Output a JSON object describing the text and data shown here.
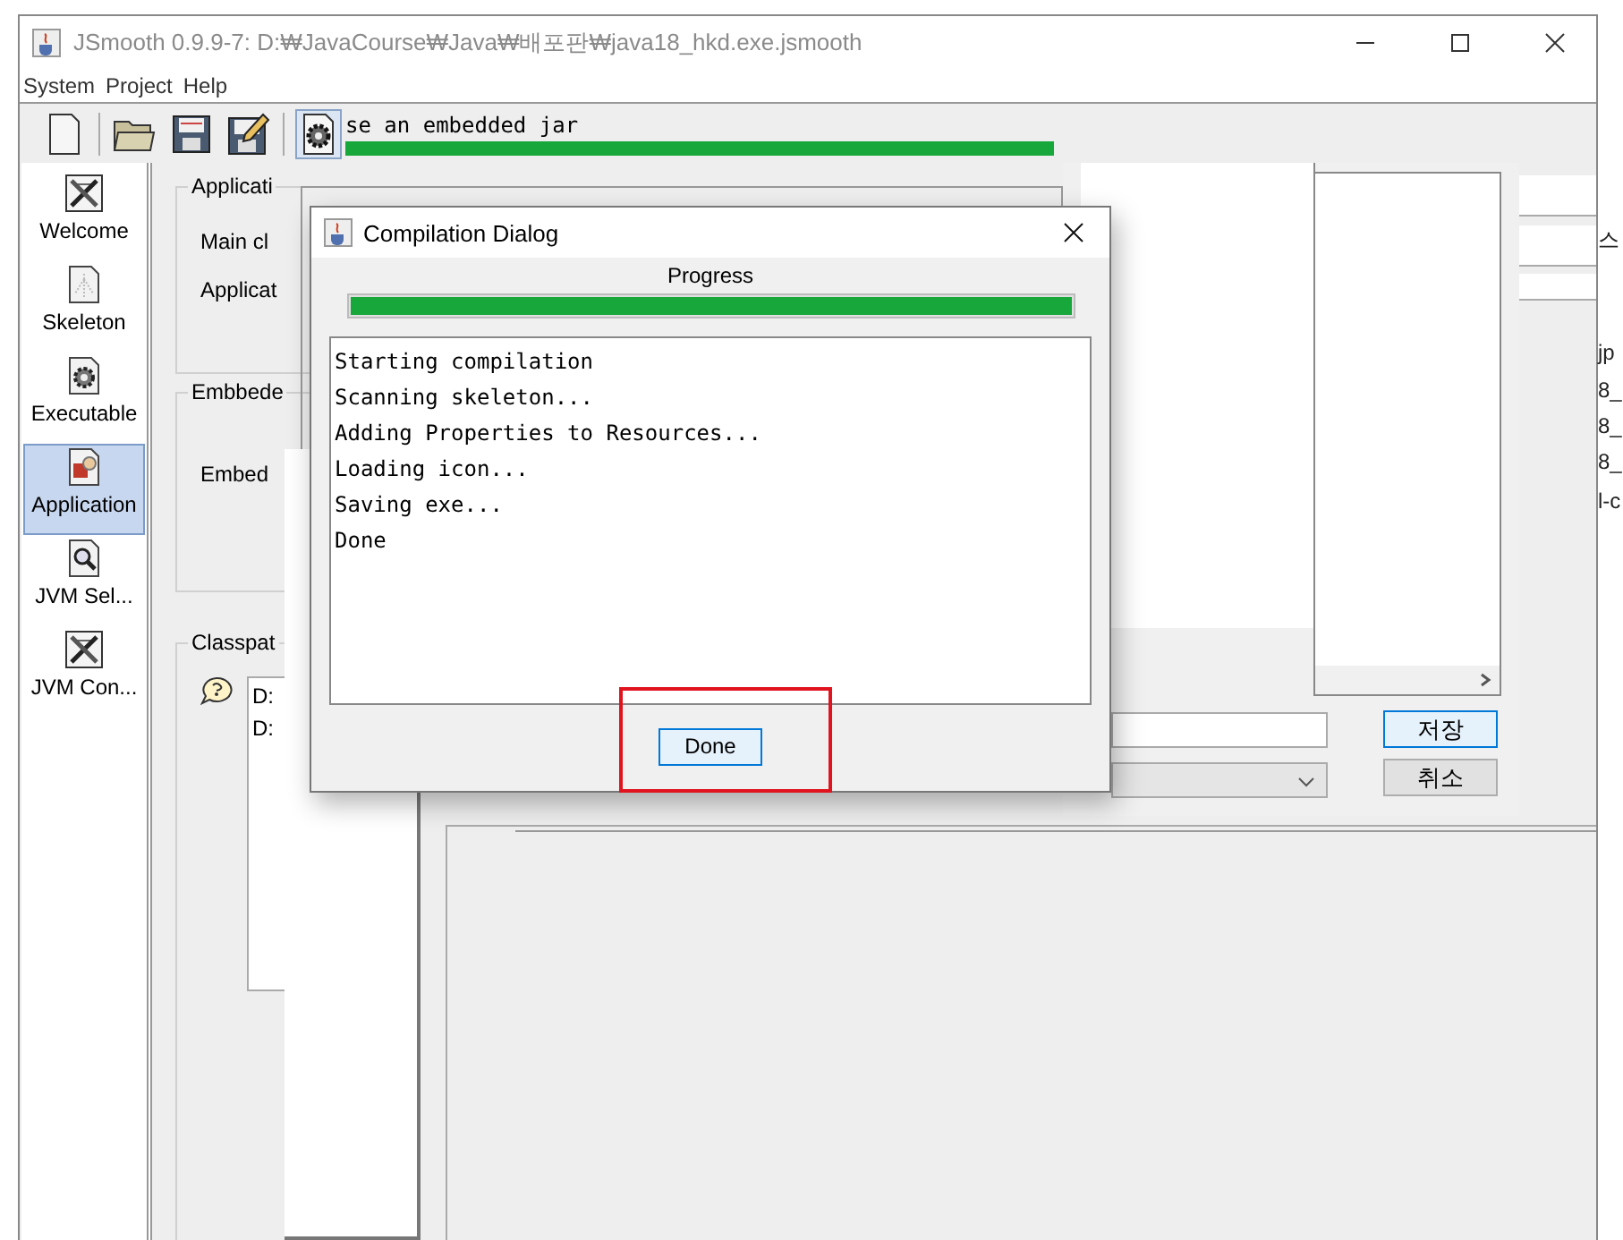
{
  "desktop": {
    "right_edge": [
      "스",
      "jp",
      "8_",
      "8_",
      "8_",
      "l-c"
    ]
  },
  "window": {
    "title": "JSmooth 0.9.9-7: D:₩JavaCourse₩Java₩배포판₩java18_hkd.exe.jsmooth"
  },
  "menu": [
    "System",
    "Project",
    "Help"
  ],
  "toolbar": [
    {
      "kind": "new",
      "pressed": false
    },
    {
      "kind": "open",
      "pressed": false
    },
    {
      "kind": "save",
      "pressed": false
    },
    {
      "kind": "save-as",
      "pressed": false
    },
    {
      "kind": "compile",
      "pressed": true
    }
  ],
  "sidebar": {
    "items": [
      {
        "label": "Welcome",
        "kind": "tools",
        "selected": false
      },
      {
        "label": "Skeleton",
        "kind": "skeleton",
        "selected": false
      },
      {
        "label": "Executable",
        "kind": "gear",
        "selected": false
      },
      {
        "label": "Application",
        "kind": "shapes",
        "selected": true
      },
      {
        "label": "JVM Sel...",
        "kind": "magnifier",
        "selected": false
      },
      {
        "label": "JVM Con...",
        "kind": "tools",
        "selected": false
      }
    ]
  },
  "form": {
    "groups": [
      {
        "title": "Applicati",
        "fields": [
          "Main cl",
          "Applicat"
        ]
      },
      {
        "title": "Embbede",
        "fields": [
          "Embed"
        ]
      },
      {
        "title": "Classpat",
        "list": [
          "D:",
          "D:"
        ]
      }
    ]
  },
  "background_progress": {
    "text": "se an embedded jar",
    "level": 1
  },
  "file_dialog": {
    "buttons": [
      {
        "label": "저장",
        "focused": true
      },
      {
        "label": "취소",
        "focused": false
      }
    ]
  },
  "compilation_dialog": {
    "title": "Compilation Dialog",
    "progress_label": "Progress",
    "level": 1,
    "log": [
      "Starting compilation",
      "Scanning skeleton...",
      "Adding Properties to Resources...",
      "Loading icon...",
      "Saving exe...",
      "Done"
    ],
    "button": "Done",
    "highlighted": true
  }
}
